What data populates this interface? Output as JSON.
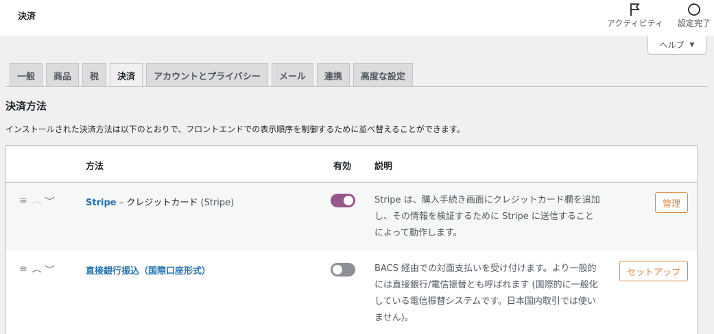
{
  "header": {
    "title": "決済",
    "activity_label": "アクティビティ",
    "finish_setup_label": "設定完了"
  },
  "help": {
    "label": "ヘルプ",
    "caret": "▼"
  },
  "tabs": [
    {
      "label": "一般",
      "active": false
    },
    {
      "label": "商品",
      "active": false
    },
    {
      "label": "税",
      "active": false
    },
    {
      "label": "決済",
      "active": true
    },
    {
      "label": "アカウントとプライバシー",
      "active": false
    },
    {
      "label": "メール",
      "active": false
    },
    {
      "label": "連携",
      "active": false
    },
    {
      "label": "高度な設定",
      "active": false
    }
  ],
  "section": {
    "title": "決済方法",
    "description": "インストールされた決済方法は以下のとおりで、フロントエンドでの表示順序を制御するために並べ替えることができます。"
  },
  "table": {
    "headers": {
      "method": "方法",
      "enabled": "有効",
      "description": "説明"
    },
    "rows": [
      {
        "name": "Stripe",
        "separator": " – ",
        "subtitle": "クレジットカード",
        "paren": " (Stripe)",
        "enabled": true,
        "description": "Stripe は、購入手続き画面にクレジットカード欄を追加し、その情報を検証するために Stripe に送信することによって動作します。",
        "action_label": "管理",
        "icons": {
          "drag": "≡",
          "up": "︿",
          "down": "﹀"
        }
      },
      {
        "name": "直接銀行振込（国際口座形式）",
        "separator": "",
        "subtitle": "",
        "paren": "",
        "enabled": false,
        "description": "BACS 経由での対面支払いを受け付けます。より一般的には直接銀行/電信振替とも呼ばれます (国際的に一般化している電信振替システムです。日本国内取引では使いません)。",
        "action_label": "セットアップ",
        "icons": {
          "drag": "≡",
          "up": "︿",
          "down": "﹀"
        }
      }
    ]
  },
  "colors": {
    "accent": "#96588a",
    "link": "#2271b1",
    "action": "#e0863e"
  }
}
